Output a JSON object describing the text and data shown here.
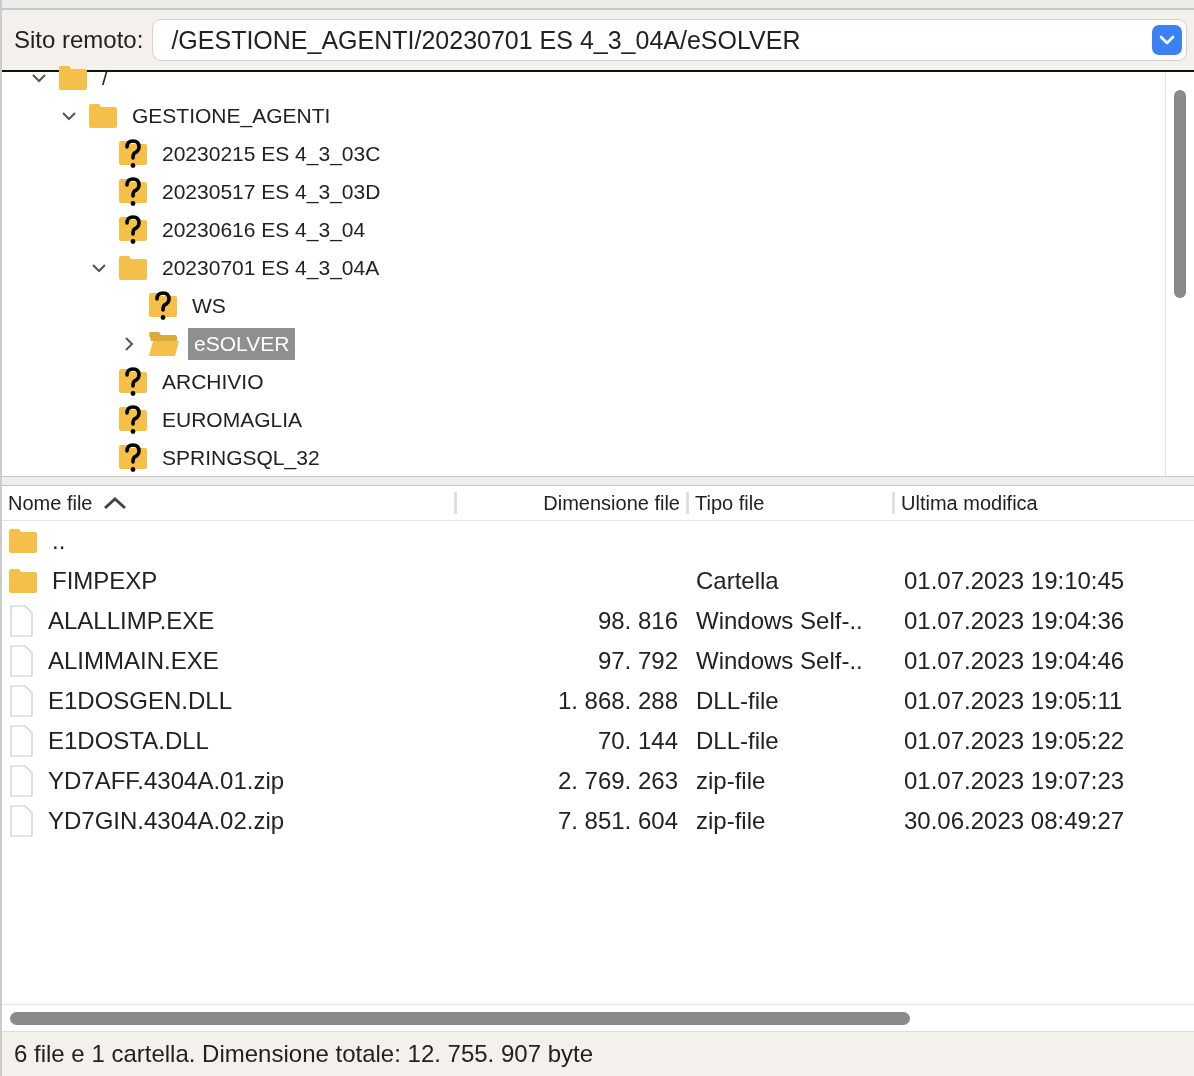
{
  "remote_site": {
    "label": "Sito remoto:",
    "path": "/GESTIONE_AGENTI/20230701 ES 4_3_04A/eSOLVER"
  },
  "tree": [
    {
      "name": "/",
      "kind": "folder",
      "expanded": true,
      "selected": false,
      "children": [
        {
          "name": "GESTIONE_AGENTI",
          "kind": "folder",
          "expanded": true,
          "selected": false,
          "children": [
            {
              "name": "20230215 ES 4_3_03C",
              "kind": "unknown",
              "selected": false
            },
            {
              "name": "20230517 ES 4_3_03D",
              "kind": "unknown",
              "selected": false
            },
            {
              "name": "20230616 ES 4_3_04",
              "kind": "unknown",
              "selected": false
            },
            {
              "name": "20230701 ES 4_3_04A",
              "kind": "folder",
              "expanded": true,
              "selected": false,
              "children": [
                {
                  "name": "WS",
                  "kind": "unknown",
                  "selected": false
                },
                {
                  "name": "eSOLVER",
                  "kind": "open_folder",
                  "expanded": false,
                  "selected": true
                }
              ]
            },
            {
              "name": "ARCHIVIO",
              "kind": "unknown",
              "selected": false
            },
            {
              "name": "EUROMAGLIA",
              "kind": "unknown",
              "selected": false
            },
            {
              "name": "SPRINGSQL_32",
              "kind": "unknown",
              "selected": false
            }
          ]
        }
      ]
    }
  ],
  "file_list": {
    "columns": [
      {
        "label": "Nome file",
        "sorted": true
      },
      {
        "label": "Dimensione file",
        "sorted": false
      },
      {
        "label": "Tipo file",
        "sorted": false
      },
      {
        "label": "Ultima modifica",
        "sorted": false
      }
    ],
    "rows": [
      {
        "kind": "folder",
        "name": ".."
      },
      {
        "kind": "folder",
        "name": "FIMPEXP",
        "type": "Cartella",
        "modified": "01.07.2023 19:10:45"
      },
      {
        "kind": "file",
        "name": "ALALLIMP.EXE",
        "size": "98. 816",
        "type": "Windows Self-..",
        "modified": "01.07.2023 19:04:36"
      },
      {
        "kind": "file",
        "name": "ALIMMAIN.EXE",
        "size": "97. 792",
        "type": "Windows Self-..",
        "modified": "01.07.2023 19:04:46"
      },
      {
        "kind": "file",
        "name": "E1DOSGEN.DLL",
        "size": "1. 868. 288",
        "type": "DLL-file",
        "modified": "01.07.2023 19:05:11"
      },
      {
        "kind": "file",
        "name": "E1DOSTA.DLL",
        "size": "70. 144",
        "type": "DLL-file",
        "modified": "01.07.2023 19:05:22"
      },
      {
        "kind": "file",
        "name": "YD7AFF.4304A.01.zip",
        "size": "2. 769. 263",
        "type": "zip-file",
        "modified": "01.07.2023 19:07:23"
      },
      {
        "kind": "file",
        "name": "YD7GIN.4304A.02.zip",
        "size": "7. 851. 604",
        "type": "zip-file",
        "modified": "30.06.2023 08:49:27"
      }
    ]
  },
  "status_bar": "6 file e 1 cartella. Dimensione totale: 12. 755. 907 byte"
}
